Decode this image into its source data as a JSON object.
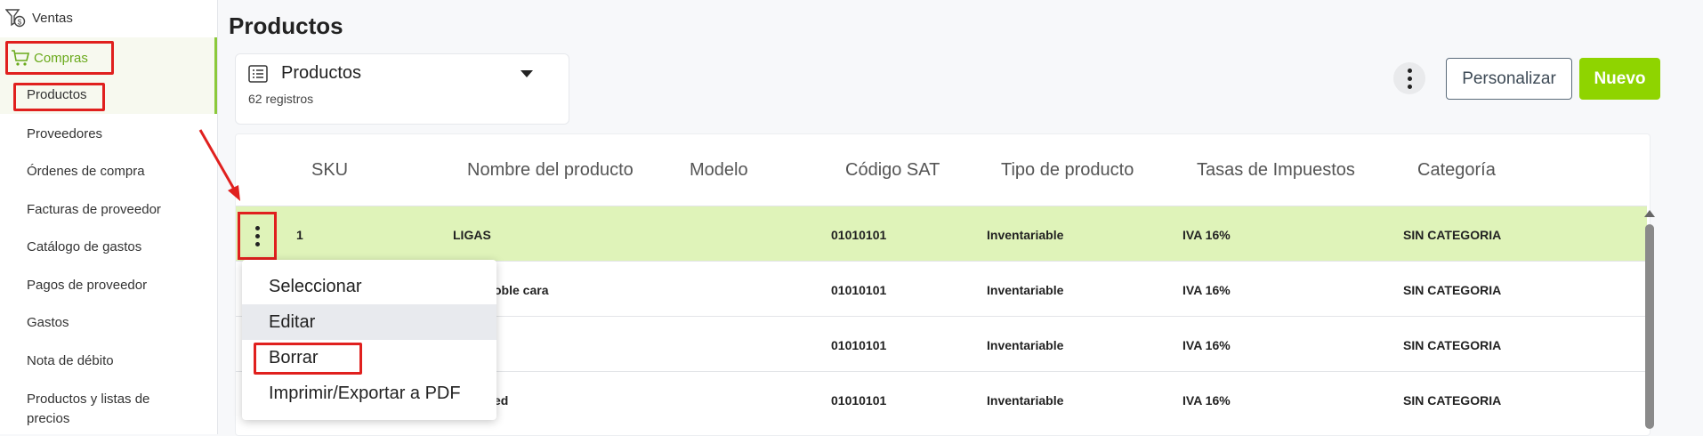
{
  "sidebar": {
    "ventas": "Ventas",
    "compras": "Compras",
    "items": [
      {
        "label": "Productos"
      },
      {
        "label": "Proveedores"
      },
      {
        "label": "Órdenes de compra"
      },
      {
        "label": "Facturas de proveedor"
      },
      {
        "label": "Catálogo de gastos"
      },
      {
        "label": "Pagos de proveedor"
      },
      {
        "label": "Gastos"
      },
      {
        "label": "Nota de débito"
      },
      {
        "label_line1": "Productos y listas de",
        "label_line2": "precios"
      }
    ]
  },
  "header": {
    "title": "Productos",
    "view_name": "Productos",
    "record_count": "62 registros",
    "customize_label": "Personalizar",
    "new_label": "Nuevo"
  },
  "table": {
    "columns": [
      "SKU",
      "Nombre del producto",
      "Modelo",
      "Código SAT",
      "Tipo de producto",
      "Tasas de Impuestos",
      "Categoría"
    ],
    "rows": [
      {
        "sku": "1",
        "name": "LIGAS",
        "model": "",
        "sat": "01010101",
        "type": "Inventariable",
        "tax": "IVA 16%",
        "category": "SIN CATEGORIA"
      },
      {
        "sku": "",
        "name": "oble cara",
        "model": "",
        "sat": "01010101",
        "type": "Inventariable",
        "tax": "IVA 16%",
        "category": "SIN CATEGORIA"
      },
      {
        "sku": "",
        "name": "",
        "model": "",
        "sat": "01010101",
        "type": "Inventariable",
        "tax": "IVA 16%",
        "category": "SIN CATEGORIA"
      },
      {
        "sku": "",
        "name": "ed",
        "model": "",
        "sat": "01010101",
        "type": "Inventariable",
        "tax": "IVA 16%",
        "category": "SIN CATEGORIA"
      }
    ]
  },
  "context_menu": {
    "items": [
      "Seleccionar",
      "Editar",
      "Borrar",
      "Imprimir/Exportar a PDF"
    ]
  },
  "colors": {
    "accent": "#8fd400",
    "row_highlight": "#dff3b9",
    "annotation": "#e0201e"
  }
}
